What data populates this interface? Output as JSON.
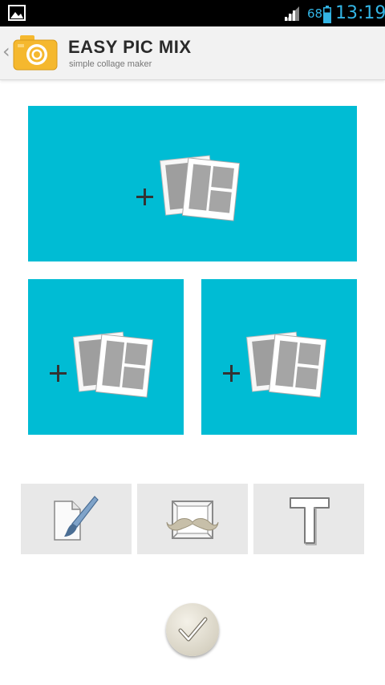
{
  "status_bar": {
    "battery_percent": "68",
    "time": "13:19",
    "icons": [
      "gallery-icon",
      "signal-icon",
      "battery-icon"
    ],
    "accent_color": "#33b5e5"
  },
  "app_bar": {
    "title": "EASY PIC MIX",
    "subtitle": "simple collage maker",
    "back_glyph": "‹",
    "logo_icon": "camera-icon",
    "logo_color": "#f5b82e"
  },
  "collage": {
    "tile_color": "#00bcd4",
    "tiles": [
      {
        "name": "top",
        "action": "+"
      },
      {
        "name": "bottom-left",
        "action": "+"
      },
      {
        "name": "bottom-right",
        "action": "+"
      }
    ]
  },
  "toolbar": {
    "tools": [
      {
        "name": "draw-tool",
        "icon": "paintbrush-icon"
      },
      {
        "name": "frame-tool",
        "icon": "mustache-frame-icon"
      },
      {
        "name": "text-tool",
        "icon": "text-t-icon"
      }
    ]
  },
  "confirm": {
    "icon": "checkmark-icon"
  }
}
